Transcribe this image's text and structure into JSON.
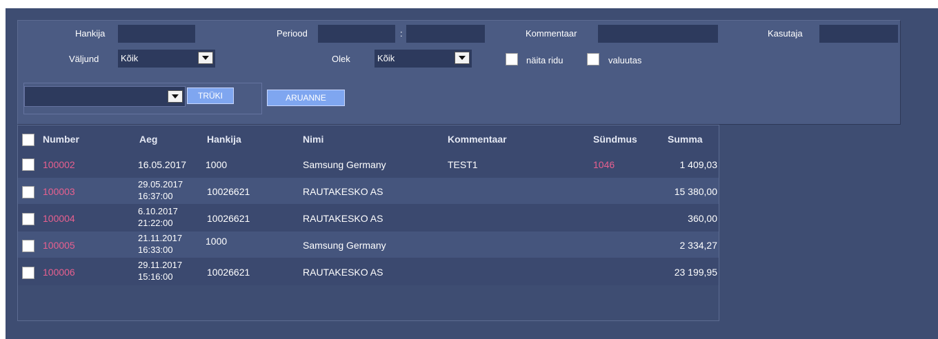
{
  "filters": {
    "supplier_label": "Hankija",
    "supplier_value": "",
    "period_label": "Periood",
    "period_from": "",
    "period_separator": ":",
    "period_to": "",
    "comment_label": "Kommentaar",
    "comment_value": "",
    "user_label": "Kasutaja",
    "user_value": "",
    "output_label": "Väljund",
    "output_value": "Kõik",
    "status_label": "Olek",
    "status_value": "Kõik",
    "show_rows_label": "näita ridu",
    "currency_label": "valuutas",
    "print_select_value": "",
    "print_button": "TRÜKI",
    "report_button": "ARUANNE"
  },
  "table": {
    "headers": [
      "Number",
      "Aeg",
      "Hankija",
      "Nimi",
      "Kommentaar",
      "Sündmus",
      "Summa"
    ],
    "rows": [
      {
        "number": "100002",
        "date": "16.05.2017",
        "time": "",
        "supplier": "1000",
        "name": "Samsung Germany",
        "comment": "TEST1",
        "event": "1046",
        "sum": "1 409,03"
      },
      {
        "number": "100003",
        "date": "29.05.2017",
        "time": "16:37:00",
        "supplier": "10026621",
        "name": "RAUTAKESKO AS",
        "comment": "",
        "event": "",
        "sum": "15 380,00"
      },
      {
        "number": "100004",
        "date": "6.10.2017",
        "time": "21:22:00",
        "supplier": "10026621",
        "name": "RAUTAKESKO AS",
        "comment": "",
        "event": "",
        "sum": "360,00"
      },
      {
        "number": "100005",
        "date": "21.11.2017",
        "time": "16:33:00",
        "supplier": "1000",
        "name": "Samsung Germany",
        "comment": "",
        "event": "",
        "sum": "2 334,27"
      },
      {
        "number": "100006",
        "date": "29.11.2017",
        "time": "15:16:00",
        "supplier": "10026621",
        "name": "RAUTAKESKO AS",
        "comment": "",
        "event": "",
        "sum": "23 199,95"
      }
    ]
  }
}
